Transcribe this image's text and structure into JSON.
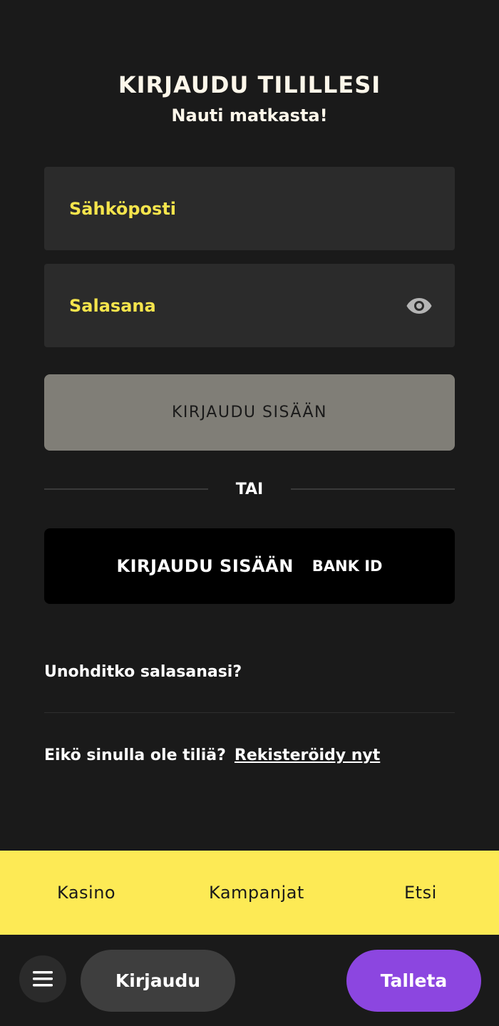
{
  "header": {
    "title": "KIRJAUDU TILILLESI",
    "subtitle": "Nauti matkasta!"
  },
  "form": {
    "email_label": "Sähköposti",
    "password_label": "Salasana",
    "password_toggle_icon": "eye-icon",
    "login_button": "KIRJAUDU SISÄÄN",
    "divider_text": "TAI",
    "bankid_button": "KIRJAUDU SISÄÄN",
    "bankid_tag": "BANK ID",
    "forgot_password": "Unohditko salasanasi?",
    "no_account_text": "Eikö sinulla ole tiliä?",
    "register_link": "Rekisteröidy nyt"
  },
  "nav": {
    "items": [
      {
        "label": "Kasino"
      },
      {
        "label": "Kampanjat"
      },
      {
        "label": "Etsi"
      }
    ]
  },
  "bottom_bar": {
    "menu_icon": "hamburger-menu-icon",
    "login_label": "Kirjaudu",
    "deposit_label": "Talleta"
  },
  "colors": {
    "background": "#1a1a1a",
    "accent_yellow": "#fdea55",
    "label_yellow": "#f5e44c",
    "field_bg": "#2b2b2b",
    "login_button_bg": "#807e77",
    "deposit_purple": "#8c46e0"
  }
}
